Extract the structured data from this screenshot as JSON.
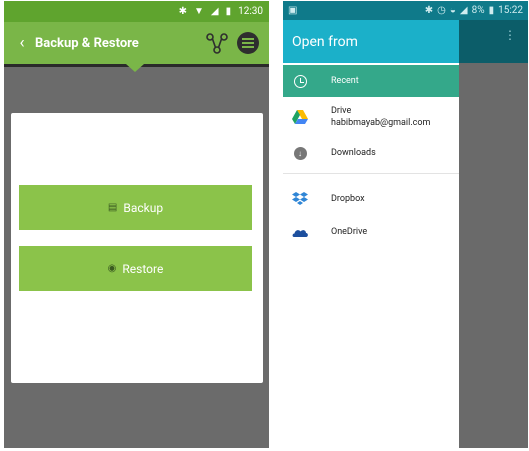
{
  "left": {
    "status": {
      "time": "12:30"
    },
    "appbar": {
      "back_glyph": "‹",
      "title": "Backup & Restore",
      "share_icon": "share-icon",
      "menu_icon": "menu-icon"
    },
    "buttons": {
      "backup_label": "Backup",
      "restore_label": "Restore"
    },
    "colors": {
      "status": "#5fa42e",
      "appbar": "#7ab648",
      "button": "#8bc34a",
      "background": "#6b6b6b"
    }
  },
  "right": {
    "status": {
      "battery": "8%",
      "time": "15:22"
    },
    "drawer": {
      "title": "Open from",
      "items": [
        {
          "label": "Recent",
          "icon": "clock-icon",
          "selected": true
        },
        {
          "label": "Drive",
          "sublabel": "habibmayab@gmail.com",
          "icon": "drive-icon"
        },
        {
          "label": "Downloads",
          "icon": "download-icon"
        },
        {
          "label": "Dropbox",
          "icon": "dropbox-icon"
        },
        {
          "label": "OneDrive",
          "icon": "onedrive-icon"
        }
      ]
    },
    "colors": {
      "header": "#1bb0c9",
      "selected": "#34a88a",
      "status": "#0f7a8a"
    }
  }
}
